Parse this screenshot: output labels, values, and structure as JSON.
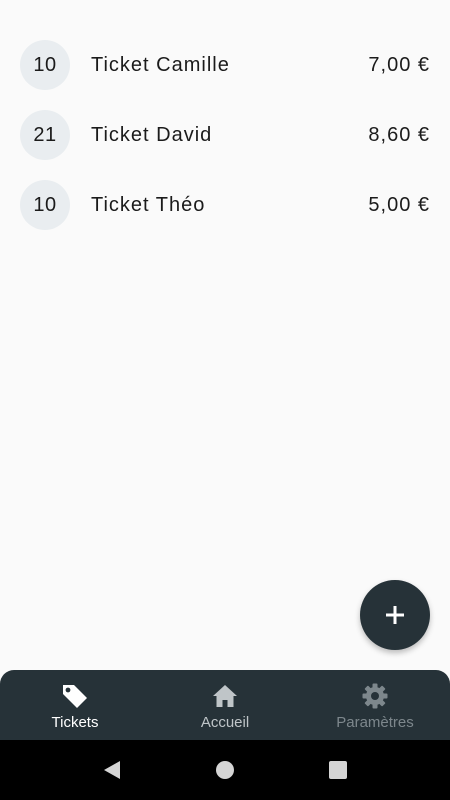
{
  "tickets": [
    {
      "count": "10",
      "name": "Ticket Camille",
      "price": "7,00 €"
    },
    {
      "count": "21",
      "name": "Ticket David",
      "price": "8,60 €"
    },
    {
      "count": "10",
      "name": "Ticket Théo",
      "price": "5,00 €"
    }
  ],
  "fab": {
    "icon": "plus-icon",
    "symbol": "+"
  },
  "bottom_nav": {
    "items": [
      {
        "label": "Tickets",
        "icon": "tag-icon",
        "active": true
      },
      {
        "label": "Accueil",
        "icon": "home-icon",
        "active": false
      },
      {
        "label": "Paramètres",
        "icon": "gear-icon",
        "active": false
      }
    ]
  },
  "colors": {
    "background": "#fafafa",
    "badge": "#e9edf0",
    "nav_background": "#263238",
    "fab_background": "#263238",
    "nav_active": "#ffffff",
    "nav_inactive": "#bfc5c8",
    "nav_disabled": "#7d878c"
  }
}
